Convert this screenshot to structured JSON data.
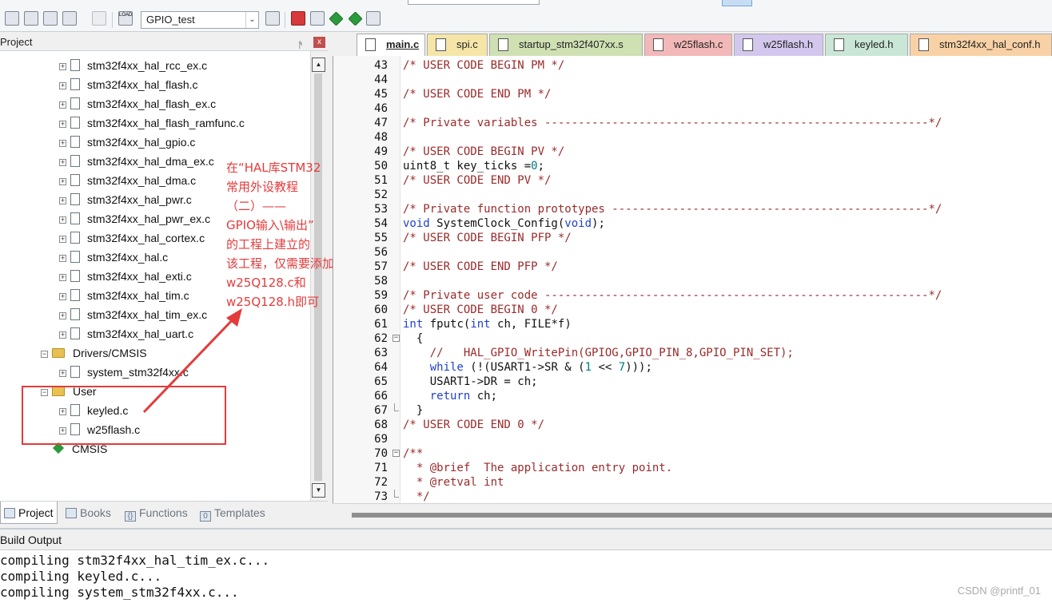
{
  "toolbar": {
    "target_name": "GPIO_test",
    "target_dropdown_arrow": "⌄",
    "load_label": "LOAD"
  },
  "project_panel": {
    "title": "Project",
    "pin_glyph": "ᚫ",
    "close_glyph": "x",
    "tree": [
      {
        "label": "stm32f4xx_hal_rcc_ex.c",
        "kind": "file",
        "expander": "+"
      },
      {
        "label": "stm32f4xx_hal_flash.c",
        "kind": "file",
        "expander": "+"
      },
      {
        "label": "stm32f4xx_hal_flash_ex.c",
        "kind": "file",
        "expander": "+"
      },
      {
        "label": "stm32f4xx_hal_flash_ramfunc.c",
        "kind": "file",
        "expander": "+"
      },
      {
        "label": "stm32f4xx_hal_gpio.c",
        "kind": "file",
        "expander": "+"
      },
      {
        "label": "stm32f4xx_hal_dma_ex.c",
        "kind": "file",
        "expander": "+"
      },
      {
        "label": "stm32f4xx_hal_dma.c",
        "kind": "file",
        "expander": "+"
      },
      {
        "label": "stm32f4xx_hal_pwr.c",
        "kind": "file",
        "expander": "+"
      },
      {
        "label": "stm32f4xx_hal_pwr_ex.c",
        "kind": "file",
        "expander": "+"
      },
      {
        "label": "stm32f4xx_hal_cortex.c",
        "kind": "file",
        "expander": "+"
      },
      {
        "label": "stm32f4xx_hal.c",
        "kind": "file",
        "expander": "+"
      },
      {
        "label": "stm32f4xx_hal_exti.c",
        "kind": "file",
        "expander": "+"
      },
      {
        "label": "stm32f4xx_hal_tim.c",
        "kind": "file",
        "expander": "+"
      },
      {
        "label": "stm32f4xx_hal_tim_ex.c",
        "kind": "file",
        "expander": "+"
      },
      {
        "label": "stm32f4xx_hal_uart.c",
        "kind": "file",
        "expander": "+"
      },
      {
        "label": "Drivers/CMSIS",
        "kind": "folder",
        "expander": "−"
      },
      {
        "label": "system_stm32f4xx.c",
        "kind": "file",
        "expander": "+"
      },
      {
        "label": "User",
        "kind": "folder",
        "expander": "−"
      },
      {
        "label": "keyled.c",
        "kind": "file",
        "expander": "+"
      },
      {
        "label": "w25flash.c",
        "kind": "file",
        "expander": "+"
      },
      {
        "label": "CMSIS",
        "kind": "component",
        "expander": ""
      }
    ],
    "annotation_lines": [
      "在“HAL库STM32",
      "常用外设教程",
      "（二）——",
      "GPIO输入\\输出”",
      "的工程上建立的",
      "该工程，仅需要添加",
      "w25Q128.c和",
      "w25Q128.h即可"
    ],
    "tabs": [
      "Project",
      "Books",
      "Functions",
      "Templates"
    ],
    "tab_glyphs": [
      "",
      "",
      "{}",
      "0"
    ],
    "annotation_color": "#e33b3b"
  },
  "editor": {
    "tabs": [
      {
        "label": "main.c",
        "color": "#ffffff",
        "active": true
      },
      {
        "label": "spi.c",
        "color": "#f5e6a8",
        "active": false
      },
      {
        "label": "startup_stm32f407xx.s",
        "color": "#cfe0b3",
        "active": false
      },
      {
        "label": "w25flash.c",
        "color": "#f3b8b8",
        "active": false
      },
      {
        "label": "w25flash.h",
        "color": "#d4c7ee",
        "active": false
      },
      {
        "label": "keyled.h",
        "color": "#c9e6d6",
        "active": false
      },
      {
        "label": "stm32f4xx_hal_conf.h",
        "color": "#f8d2a6",
        "active": false
      }
    ],
    "lines": [
      {
        "n": "43",
        "fold": "",
        "segs": [
          {
            "t": "/* USER CODE BEGIN PM */",
            "c": "cm"
          }
        ]
      },
      {
        "n": "44",
        "fold": "",
        "segs": []
      },
      {
        "n": "45",
        "fold": "",
        "segs": [
          {
            "t": "/* USER CODE END PM */",
            "c": "cm"
          }
        ]
      },
      {
        "n": "46",
        "fold": "",
        "segs": []
      },
      {
        "n": "47",
        "fold": "",
        "segs": [
          {
            "t": "/* Private variables ---------------------------------------------------------*/",
            "c": "cm"
          }
        ]
      },
      {
        "n": "48",
        "fold": "",
        "segs": []
      },
      {
        "n": "49",
        "fold": "",
        "segs": [
          {
            "t": "/* USER CODE BEGIN PV */",
            "c": "cm"
          }
        ]
      },
      {
        "n": "50",
        "fold": "",
        "segs": [
          {
            "t": "uint8_t key_ticks =",
            "c": ""
          },
          {
            "t": "0",
            "c": "num"
          },
          {
            "t": ";",
            "c": ""
          }
        ]
      },
      {
        "n": "51",
        "fold": "",
        "segs": [
          {
            "t": "/* USER CODE END PV */",
            "c": "cm"
          }
        ]
      },
      {
        "n": "52",
        "fold": "",
        "segs": []
      },
      {
        "n": "53",
        "fold": "",
        "segs": [
          {
            "t": "/* Private function prototypes -----------------------------------------------*/",
            "c": "cm"
          }
        ]
      },
      {
        "n": "54",
        "fold": "",
        "segs": [
          {
            "t": "void",
            "c": "kw"
          },
          {
            "t": " SystemClock_Config(",
            "c": ""
          },
          {
            "t": "void",
            "c": "kw"
          },
          {
            "t": ");",
            "c": ""
          }
        ]
      },
      {
        "n": "55",
        "fold": "",
        "segs": [
          {
            "t": "/* USER CODE BEGIN PFP */",
            "c": "cm"
          }
        ]
      },
      {
        "n": "56",
        "fold": "",
        "segs": []
      },
      {
        "n": "57",
        "fold": "",
        "segs": [
          {
            "t": "/* USER CODE END PFP */",
            "c": "cm"
          }
        ]
      },
      {
        "n": "58",
        "fold": "",
        "segs": []
      },
      {
        "n": "59",
        "fold": "",
        "segs": [
          {
            "t": "/* Private user code ---------------------------------------------------------*/",
            "c": "cm"
          }
        ]
      },
      {
        "n": "60",
        "fold": "",
        "segs": [
          {
            "t": "/* USER CODE BEGIN 0 */",
            "c": "cm"
          }
        ]
      },
      {
        "n": "61",
        "fold": "",
        "segs": [
          {
            "t": "int",
            "c": "kw"
          },
          {
            "t": " fputc(",
            "c": ""
          },
          {
            "t": "int",
            "c": "kw"
          },
          {
            "t": " ch, FILE*f)",
            "c": ""
          }
        ]
      },
      {
        "n": "62",
        "fold": "open",
        "segs": [
          {
            "t": "  {",
            "c": ""
          }
        ]
      },
      {
        "n": "63",
        "fold": "",
        "segs": [
          {
            "t": "    //   HAL_GPIO_WritePin(GPIOG,GPIO_PIN_8,GPIO_PIN_SET);",
            "c": "cm"
          }
        ]
      },
      {
        "n": "64",
        "fold": "",
        "segs": [
          {
            "t": "    ",
            "c": ""
          },
          {
            "t": "while",
            "c": "kw"
          },
          {
            "t": " (!(USART1->SR & (",
            "c": ""
          },
          {
            "t": "1",
            "c": "num"
          },
          {
            "t": " << ",
            "c": ""
          },
          {
            "t": "7",
            "c": "num"
          },
          {
            "t": ")));",
            "c": ""
          }
        ]
      },
      {
        "n": "65",
        "fold": "",
        "segs": [
          {
            "t": "    USART1->DR = ch;",
            "c": ""
          }
        ]
      },
      {
        "n": "66",
        "fold": "",
        "segs": [
          {
            "t": "    ",
            "c": ""
          },
          {
            "t": "return",
            "c": "kw"
          },
          {
            "t": " ch;",
            "c": ""
          }
        ]
      },
      {
        "n": "67",
        "fold": "end",
        "segs": [
          {
            "t": "  }",
            "c": ""
          }
        ]
      },
      {
        "n": "68",
        "fold": "",
        "segs": [
          {
            "t": "/* USER CODE END 0 */",
            "c": "cm"
          }
        ]
      },
      {
        "n": "69",
        "fold": "",
        "segs": []
      },
      {
        "n": "70",
        "fold": "open",
        "segs": [
          {
            "t": "/**",
            "c": "cm"
          }
        ]
      },
      {
        "n": "71",
        "fold": "",
        "segs": [
          {
            "t": "  * @brief  The application entry point.",
            "c": "cm"
          }
        ]
      },
      {
        "n": "72",
        "fold": "",
        "segs": [
          {
            "t": "  * @retval int",
            "c": "cm"
          }
        ]
      },
      {
        "n": "73",
        "fold": "end",
        "segs": [
          {
            "t": "  */",
            "c": "cm"
          }
        ]
      }
    ]
  },
  "build_output": {
    "title": "Build Output",
    "lines": [
      "compiling stm32f4xx_hal_tim_ex.c...",
      "compiling keyled.c...",
      "compiling system_stm32f4xx.c..."
    ]
  },
  "watermark": "CSDN @printf_01"
}
